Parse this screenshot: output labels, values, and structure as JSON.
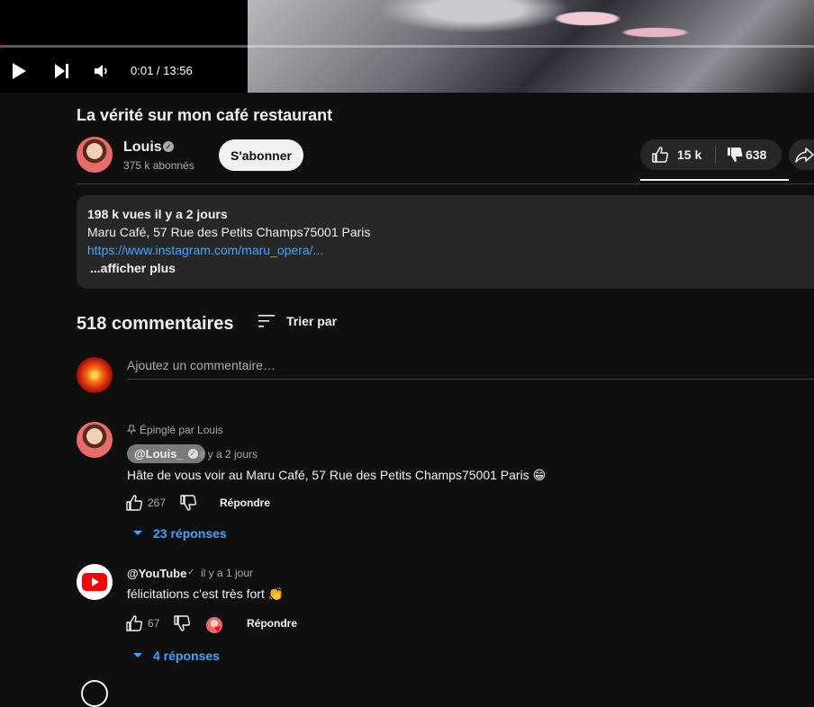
{
  "player": {
    "time_display": "0:01 / 13:56",
    "progress_fraction": 0.0012
  },
  "video": {
    "title": "La vérité sur mon café restaurant"
  },
  "channel": {
    "name": "Louis",
    "subscribers": "375 k abonnés",
    "subscribe_label": "S'abonner"
  },
  "actions": {
    "likes": "15 k",
    "dislikes": "638"
  },
  "description": {
    "stats": "198 k vues  il y a 2 jours",
    "address": "Maru Café, 57 Rue des Petits Champs75001 Paris",
    "link": "https://www.instagram.com/maru_opera/...",
    "more": "...afficher plus"
  },
  "comments": {
    "count_label": "518 commentaires",
    "sort_label": "Trier par",
    "add_placeholder": "Ajoutez un commentaire…",
    "items": [
      {
        "pinned_label": "Épinglé par Louis",
        "author": "@Louis_",
        "time": "il y a 2 jours",
        "text": "Hâte de vous voir au Maru Café, 57 Rue des Petits Champs75001 Paris 😁",
        "likes": "267",
        "reply_label": "Répondre",
        "replies_label": "23 réponses"
      },
      {
        "author": "@YouTube",
        "time": "il y a 1 jour",
        "text": "félicitations c'est très fort 👏",
        "likes": "67",
        "reply_label": "Répondre",
        "replies_label": "4 réponses"
      }
    ]
  },
  "icons": {
    "play": "play-icon",
    "next": "next-icon",
    "volume": "volume-icon",
    "like": "thumb-up-icon",
    "dislike": "thumb-down-icon",
    "share": "share-icon",
    "sort": "sort-icon",
    "pin": "pin-icon",
    "chevron": "chevron-down-icon"
  },
  "colors": {
    "background": "#0f0f0f",
    "link": "#3ea6ff",
    "progress": "#ff0000",
    "youtube_red": "#ff0000"
  }
}
